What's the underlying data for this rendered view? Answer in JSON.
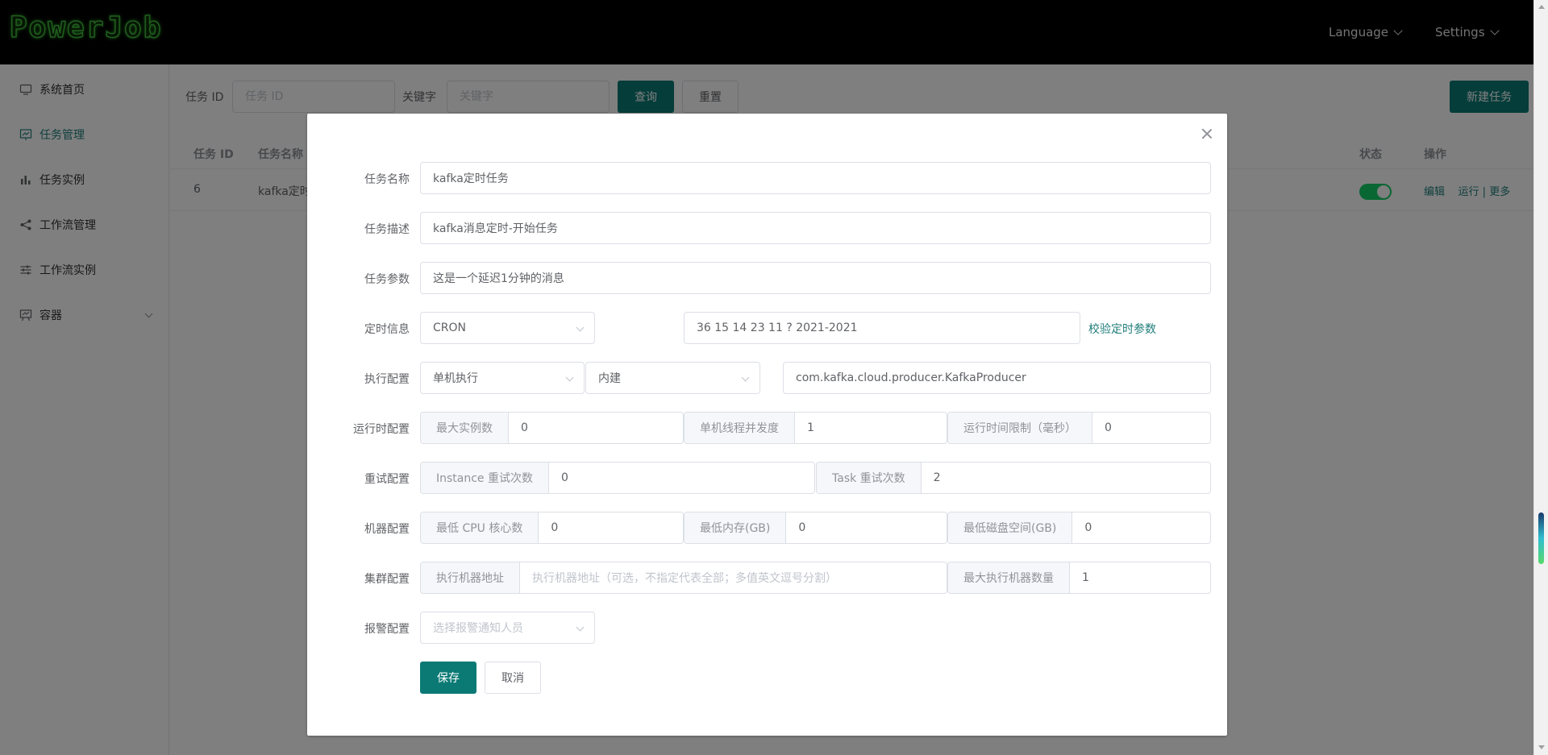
{
  "app": {
    "logo_text": "PowerJob",
    "header_menu": [
      "Language",
      "Settings"
    ]
  },
  "sidebar": {
    "items": [
      {
        "label": "系统首页",
        "icon": "monitor-icon"
      },
      {
        "label": "任务管理",
        "icon": "chart-line-icon"
      },
      {
        "label": "任务实例",
        "icon": "bar-chart-icon"
      },
      {
        "label": "工作流管理",
        "icon": "share-icon"
      },
      {
        "label": "工作流实例",
        "icon": "sliders-icon"
      },
      {
        "label": "容器",
        "icon": "easel-icon"
      }
    ]
  },
  "search": {
    "job_id_label": "任务 ID",
    "job_id_placeholder": "任务 ID",
    "keyword_label": "关键字",
    "keyword_placeholder": "关键字",
    "query_button": "查询",
    "reset_button": "重置",
    "new_job_button": "新建任务"
  },
  "table": {
    "columns": [
      "任务 ID",
      "任务名称",
      "状态",
      "操作"
    ],
    "rows": [
      {
        "id": "6",
        "name": "kafka定时",
        "enabled": true,
        "ops": [
          "编辑",
          "运行 | 更多"
        ]
      }
    ]
  },
  "dialog": {
    "labels": {
      "name": "任务名称",
      "desc": "任务描述",
      "params": "任务参数",
      "timing": "定时信息",
      "exec": "执行配置",
      "runtime": "运行时配置",
      "retry": "重试配置",
      "machine": "机器配置",
      "cluster": "集群配置",
      "alarm": "报警配置"
    },
    "job_name": "kafka定时任务",
    "job_description": "kafka消息定时-开始任务",
    "job_params": "这是一个延迟1分钟的消息",
    "time_expression_type": "CRON",
    "time_expression": "36 15 14 23 11 ? 2021-2021",
    "validate_link": "校验定时参数",
    "execute_type": "单机执行",
    "processor_type": "内建",
    "processor_info": "com.kafka.cloud.producer.KafkaProducer",
    "runtime": {
      "max_instance_label": "最大实例数",
      "max_instance": "0",
      "concurrency_label": "单机线程并发度",
      "concurrency": "1",
      "time_limit_label": "运行时间限制（毫秒）",
      "time_limit": "0"
    },
    "retry": {
      "instance_label": "Instance 重试次数",
      "instance": "0",
      "task_label": "Task 重试次数",
      "task": "2"
    },
    "machine": {
      "cpu_label": "最低 CPU 核心数",
      "cpu": "0",
      "memory_label": "最低内存(GB)",
      "memory": "0",
      "disk_label": "最低磁盘空间(GB)",
      "disk": "0"
    },
    "cluster": {
      "designated_label": "执行机器地址",
      "designated_placeholder": "执行机器地址（可选，不指定代表全部；多值英文逗号分割）",
      "max_worker_label": "最大执行机器数量",
      "max_worker": "1"
    },
    "alarm_placeholder": "选择报警通知人员",
    "save_button": "保存",
    "cancel_button": "取消"
  },
  "colors": {
    "accent": "#0b7a75",
    "switch_on": "#13ce66"
  }
}
